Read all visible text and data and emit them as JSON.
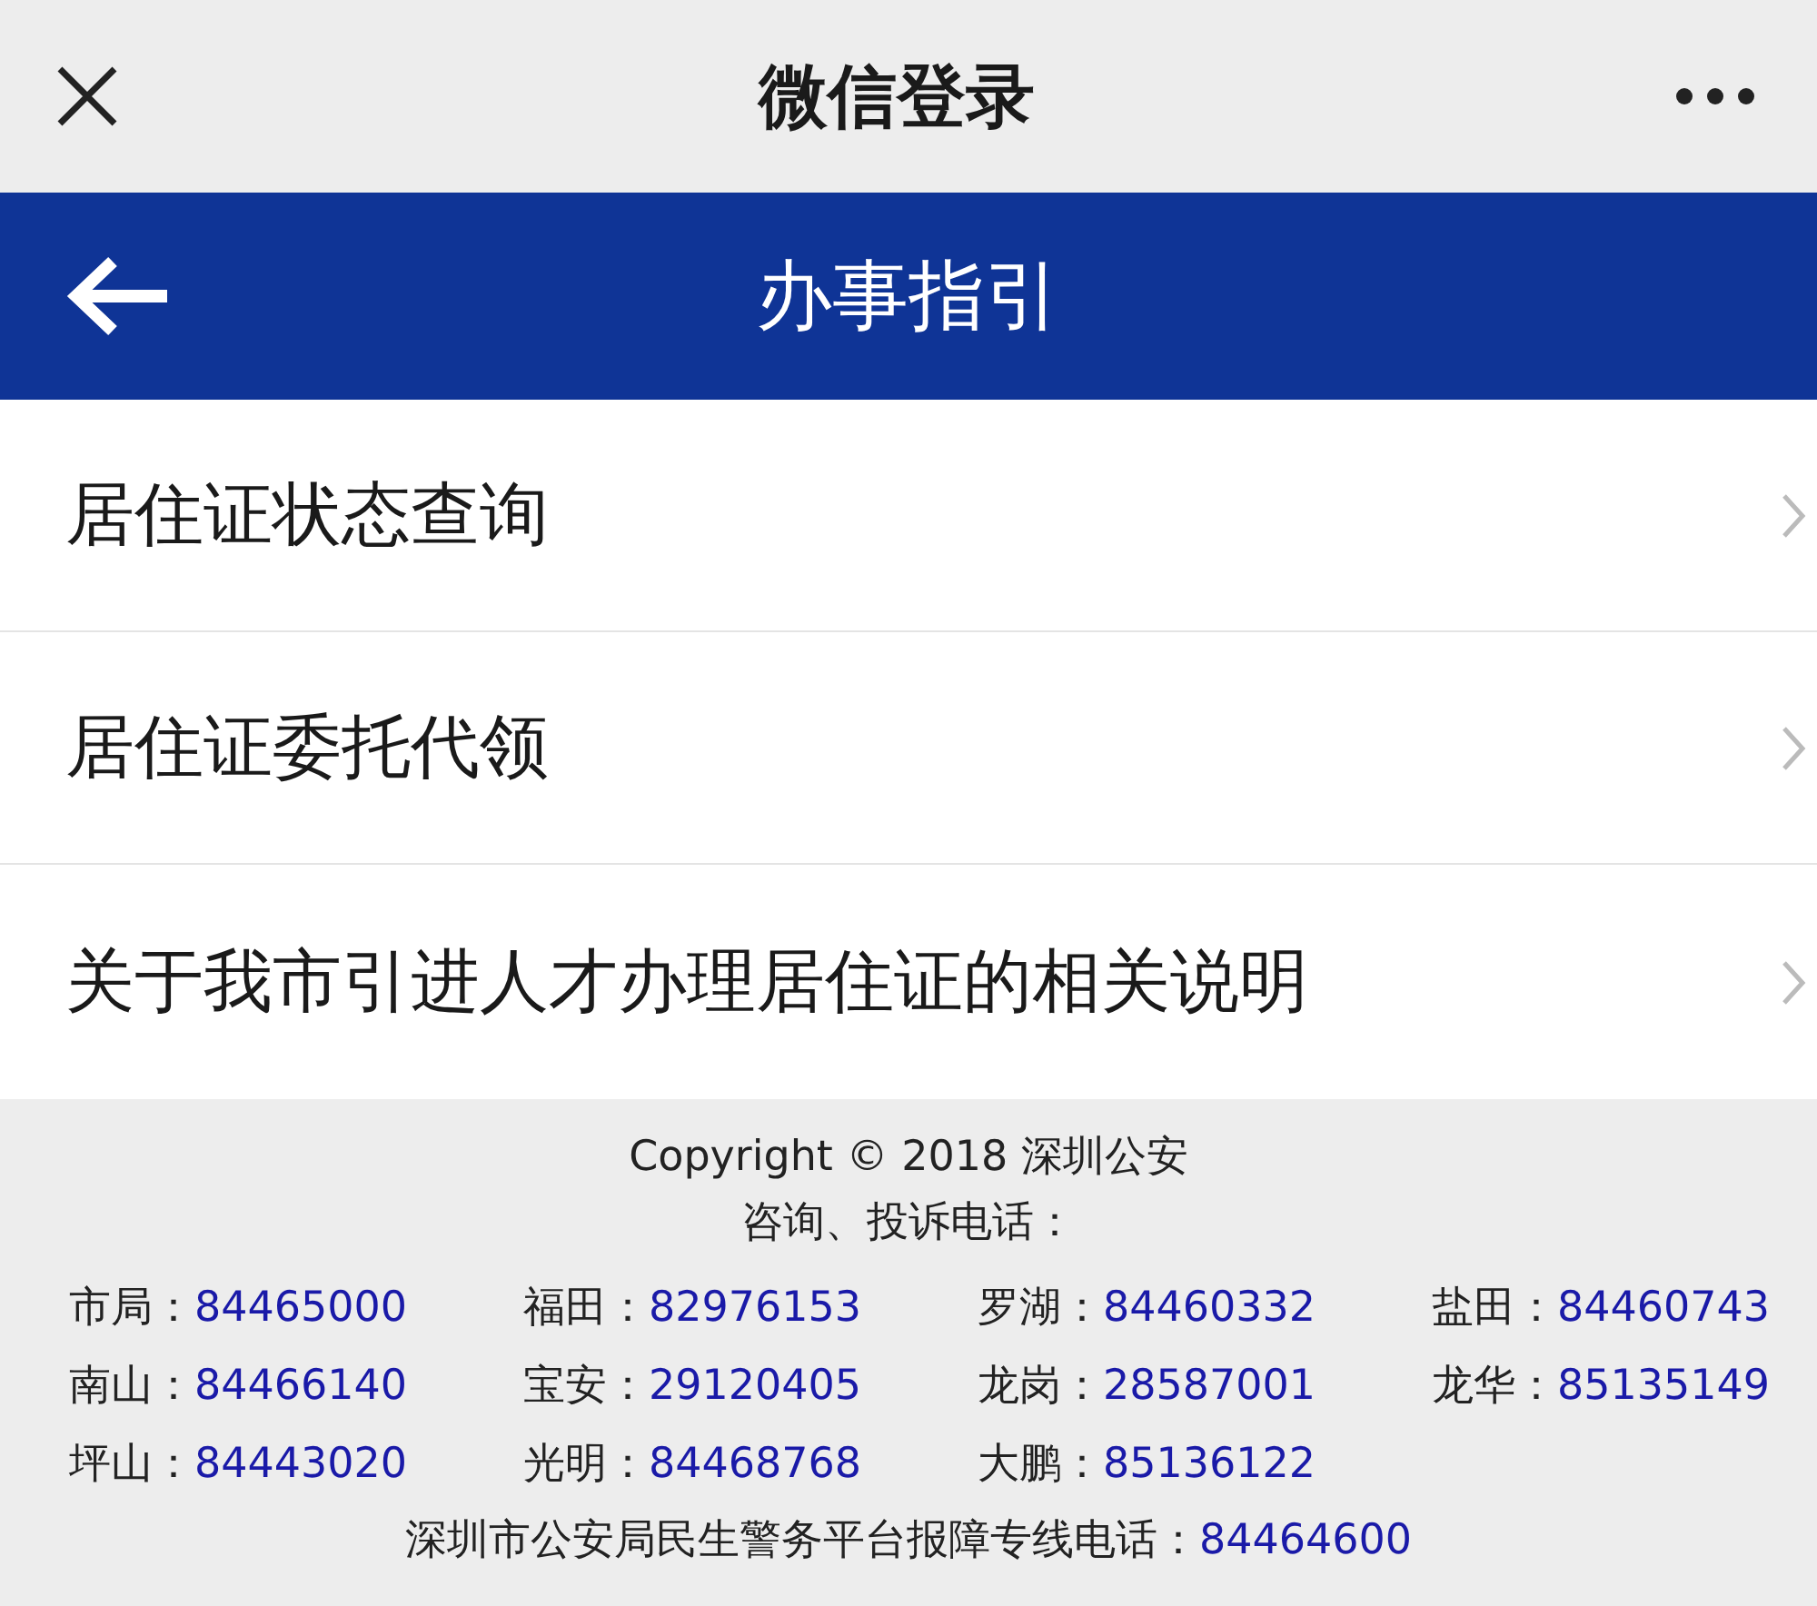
{
  "top_bar": {
    "title": "微信登录"
  },
  "header": {
    "title": "办事指引"
  },
  "menu_items": [
    {
      "label": "居住证状态查询"
    },
    {
      "label": "居住证委托代领"
    },
    {
      "label": "关于我市引进人才办理居住证的相关说明"
    }
  ],
  "footer": {
    "copyright": "Copyright © 2018 深圳公安",
    "contacts_heading": "咨询、投诉电话：",
    "contacts": [
      {
        "district": "市局：",
        "phone": "84465000"
      },
      {
        "district": "福田：",
        "phone": "82976153"
      },
      {
        "district": "罗湖：",
        "phone": "84460332"
      },
      {
        "district": "盐田：",
        "phone": "84460743"
      },
      {
        "district": "南山：",
        "phone": "84466140"
      },
      {
        "district": "宝安：",
        "phone": "29120405"
      },
      {
        "district": "龙岗：",
        "phone": "28587001"
      },
      {
        "district": "龙华：",
        "phone": "85135149"
      },
      {
        "district": "坪山：",
        "phone": "84443020"
      },
      {
        "district": "光明：",
        "phone": "84468768"
      },
      {
        "district": "大鹏：",
        "phone": "85136122"
      }
    ],
    "hotline": {
      "label": "深圳市公安局民生警务平台报障专线电话：",
      "phone": "84464600"
    }
  }
}
